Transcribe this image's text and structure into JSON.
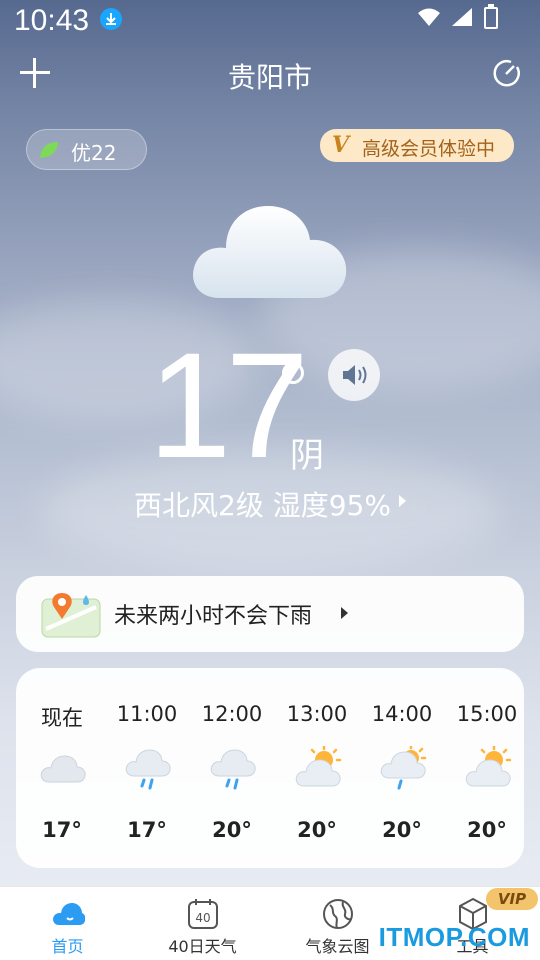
{
  "status_bar": {
    "time": "10:43"
  },
  "header": {
    "city": "贵阳市"
  },
  "air_quality": {
    "label": "优22"
  },
  "vip_trial": {
    "badge": "V",
    "label": "高级会员体验中"
  },
  "current": {
    "temperature": "17",
    "condition": "阴",
    "wind_humidity": "西北风2级  湿度95%"
  },
  "rain_forecast": {
    "text": "未来两小时不会下雨"
  },
  "hourly": [
    {
      "time": "现在",
      "icon": "cloudy-icon",
      "temp": "17°"
    },
    {
      "time": "11:00",
      "icon": "rain-icon",
      "temp": "17°"
    },
    {
      "time": "12:00",
      "icon": "rain-icon",
      "temp": "20°"
    },
    {
      "time": "13:00",
      "icon": "partly-sunny-icon",
      "temp": "20°"
    },
    {
      "time": "14:00",
      "icon": "sun-rain-icon",
      "temp": "20°"
    },
    {
      "time": "15:00",
      "icon": "partly-sunny-icon",
      "temp": "20°"
    }
  ],
  "tabs": [
    {
      "label": "首页",
      "icon": "home-cloud-icon",
      "active": true
    },
    {
      "label": "40日天气",
      "icon": "calendar-40-icon",
      "calendar_number": "40"
    },
    {
      "label": "气象云图",
      "icon": "globe-icon"
    },
    {
      "label": "工具",
      "icon": "tools-icon"
    }
  ],
  "vip_badge": "VIP",
  "watermark": "ITMOP.COM",
  "colors": {
    "accent": "#2b9cf2",
    "vip_gold": "#f3c46b"
  }
}
